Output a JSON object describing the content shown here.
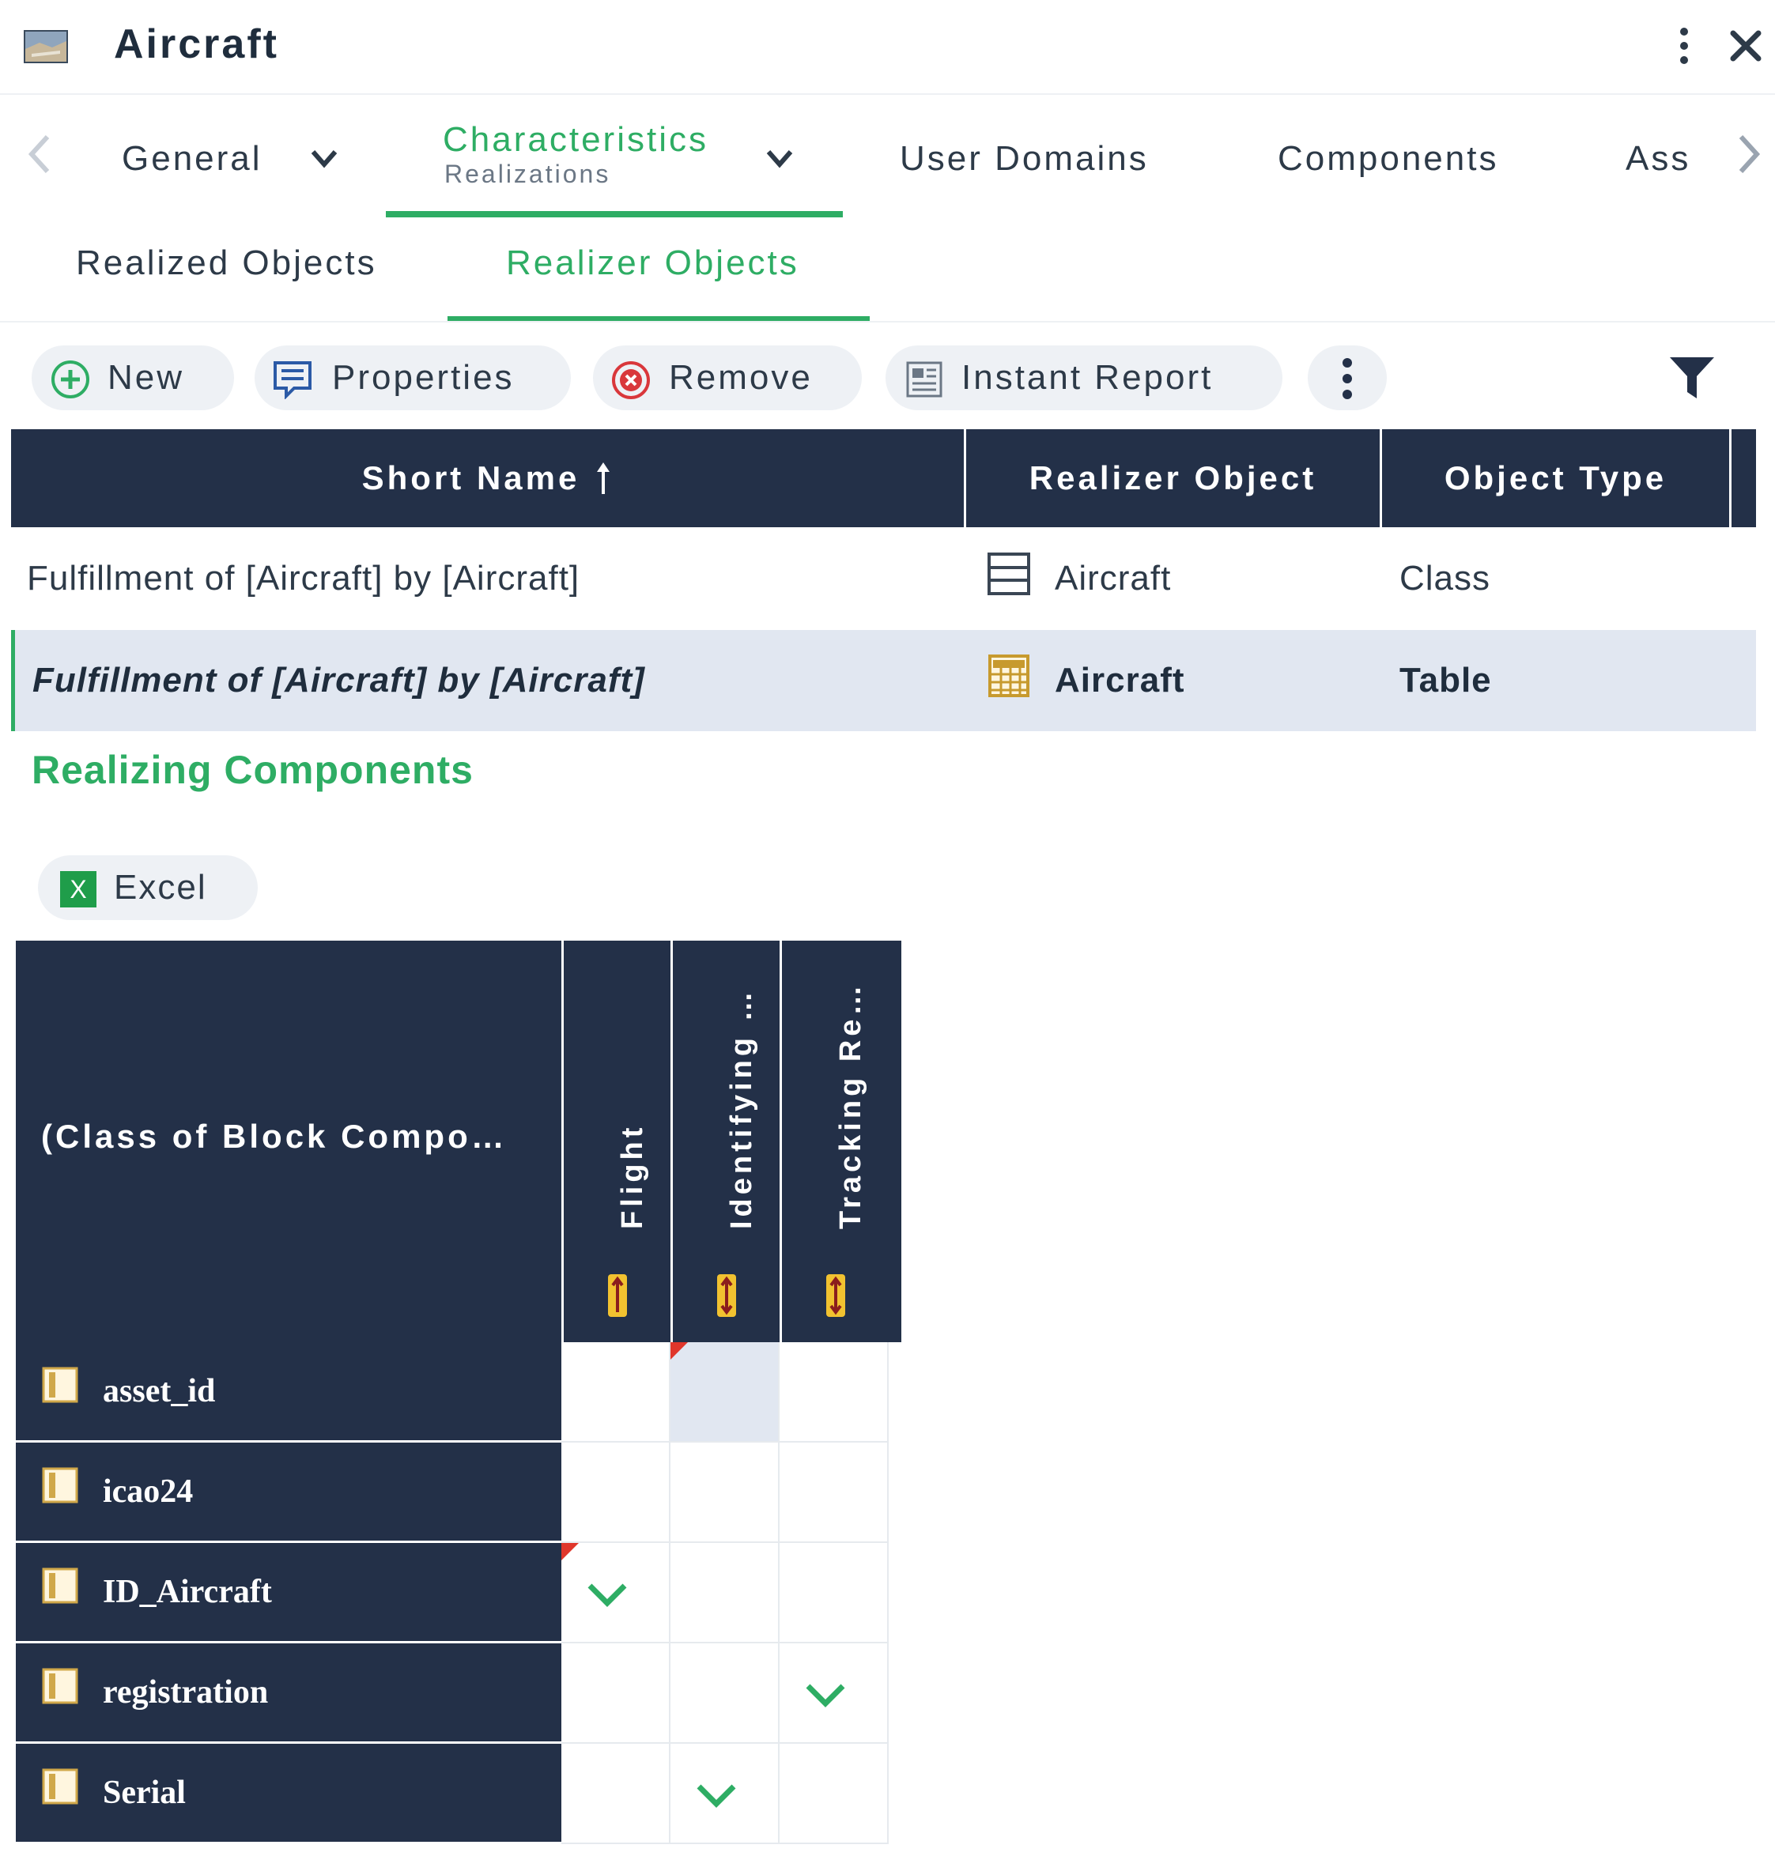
{
  "window": {
    "title": "Aircraft",
    "icon": "aircraft-thumbnail-icon"
  },
  "tabs": [
    {
      "label": "General",
      "sub": ""
    },
    {
      "label": "Characteristics",
      "sub": "Realizations"
    },
    {
      "label": "User Domains",
      "sub": ""
    },
    {
      "label": "Components",
      "sub": ""
    },
    {
      "label": "Ass",
      "sub": ""
    }
  ],
  "sub_tabs": [
    {
      "label": "Realized Objects"
    },
    {
      "label": "Realizer Objects"
    }
  ],
  "toolbar": {
    "new": "New",
    "properties": "Properties",
    "remove": "Remove",
    "instant_report": "Instant Report"
  },
  "grid": {
    "columns": [
      "Short Name",
      "Realizer Object",
      "Object Type"
    ],
    "rows": [
      {
        "short_name": "Fulfillment of [Aircraft] by [Aircraft]",
        "realizer": "Aircraft",
        "realizer_icon": "class-icon",
        "type": "Class",
        "selected": false
      },
      {
        "short_name": "Fulfillment of [Aircraft] by [Aircraft]",
        "realizer": "Aircraft",
        "realizer_icon": "table-icon",
        "type": "Table",
        "selected": true
      }
    ]
  },
  "section": {
    "title": "Realizing Components",
    "excel": "Excel"
  },
  "matrix": {
    "corner": "(Class of Block Compo…",
    "columns": [
      "Flight",
      "Identifying …",
      "Tracking Re…"
    ],
    "rows": [
      {
        "label": "asset_id",
        "checks": [
          false,
          false,
          false
        ]
      },
      {
        "label": "icao24",
        "checks": [
          false,
          false,
          false
        ]
      },
      {
        "label": "ID_Aircraft",
        "checks": [
          true,
          false,
          false
        ]
      },
      {
        "label": "registration",
        "checks": [
          false,
          false,
          true
        ]
      },
      {
        "label": "Serial",
        "checks": [
          false,
          true,
          false
        ]
      }
    ]
  },
  "colors": {
    "accent": "#2ead64",
    "header_bg": "#233048",
    "selection_bg": "#e1e7f1",
    "flag": "#e0362b"
  }
}
